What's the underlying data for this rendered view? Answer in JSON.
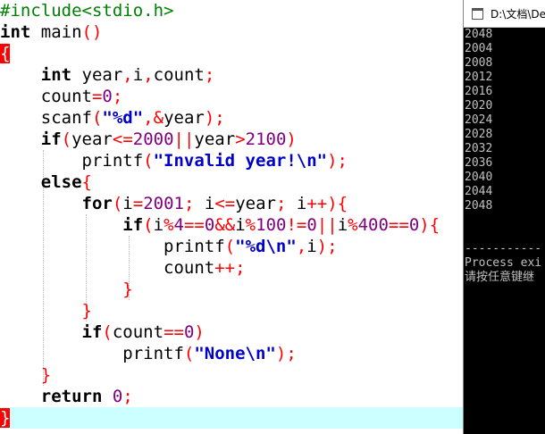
{
  "editor": {
    "lines": [
      {
        "parts": [
          {
            "t": "#include<stdio.h>",
            "c": "pp"
          }
        ]
      },
      {
        "parts": [
          {
            "t": "int",
            "c": "kw"
          },
          {
            "t": " main"
          },
          {
            "t": "()",
            "c": "op"
          }
        ]
      },
      {
        "parts": [
          {
            "t": "{",
            "c": "brace-hl"
          }
        ]
      },
      {
        "parts": [
          {
            "t": "    "
          },
          {
            "t": "int",
            "c": "kw"
          },
          {
            "t": " year"
          },
          {
            "t": ",",
            "c": "op"
          },
          {
            "t": "i"
          },
          {
            "t": ",",
            "c": "op"
          },
          {
            "t": "count"
          },
          {
            "t": ";",
            "c": "op"
          }
        ]
      },
      {
        "parts": [
          {
            "t": "    count"
          },
          {
            "t": "=",
            "c": "op"
          },
          {
            "t": "0",
            "c": "num"
          },
          {
            "t": ";",
            "c": "op"
          }
        ]
      },
      {
        "parts": [
          {
            "t": "    scanf"
          },
          {
            "t": "(",
            "c": "op"
          },
          {
            "t": "\"%d\"",
            "c": "str"
          },
          {
            "t": ",&",
            "c": "op"
          },
          {
            "t": "year"
          },
          {
            "t": ");",
            "c": "op"
          }
        ]
      },
      {
        "parts": [
          {
            "t": "    "
          },
          {
            "t": "if",
            "c": "kw"
          },
          {
            "t": "(",
            "c": "op"
          },
          {
            "t": "year"
          },
          {
            "t": "<=",
            "c": "op"
          },
          {
            "t": "2000",
            "c": "num"
          },
          {
            "t": "||",
            "c": "op"
          },
          {
            "t": "year"
          },
          {
            "t": ">",
            "c": "op"
          },
          {
            "t": "2100",
            "c": "num"
          },
          {
            "t": ")",
            "c": "op"
          }
        ]
      },
      {
        "parts": [
          {
            "t": "        printf"
          },
          {
            "t": "(",
            "c": "op"
          },
          {
            "t": "\"Invalid year!\\n\"",
            "c": "str"
          },
          {
            "t": ");",
            "c": "op"
          }
        ]
      },
      {
        "parts": [
          {
            "t": "    "
          },
          {
            "t": "else",
            "c": "kw"
          },
          {
            "t": "{",
            "c": "op"
          }
        ]
      },
      {
        "parts": [
          {
            "t": "        "
          },
          {
            "t": "for",
            "c": "kw"
          },
          {
            "t": "(",
            "c": "op"
          },
          {
            "t": "i"
          },
          {
            "t": "=",
            "c": "op"
          },
          {
            "t": "2001",
            "c": "num"
          },
          {
            "t": ";",
            "c": "op"
          },
          {
            "t": " i"
          },
          {
            "t": "<=",
            "c": "op"
          },
          {
            "t": "year"
          },
          {
            "t": ";",
            "c": "op"
          },
          {
            "t": " i"
          },
          {
            "t": "++){",
            "c": "op"
          }
        ]
      },
      {
        "parts": [
          {
            "t": "            "
          },
          {
            "t": "if",
            "c": "kw"
          },
          {
            "t": "(",
            "c": "op"
          },
          {
            "t": "i"
          },
          {
            "t": "%",
            "c": "op"
          },
          {
            "t": "4",
            "c": "num"
          },
          {
            "t": "==",
            "c": "op"
          },
          {
            "t": "0",
            "c": "num"
          },
          {
            "t": "&&",
            "c": "op"
          },
          {
            "t": "i"
          },
          {
            "t": "%",
            "c": "op"
          },
          {
            "t": "100",
            "c": "num"
          },
          {
            "t": "!=",
            "c": "op"
          },
          {
            "t": "0",
            "c": "num"
          },
          {
            "t": "||",
            "c": "op"
          },
          {
            "t": "i"
          },
          {
            "t": "%",
            "c": "op"
          },
          {
            "t": "400",
            "c": "num"
          },
          {
            "t": "==",
            "c": "op"
          },
          {
            "t": "0",
            "c": "num"
          },
          {
            "t": "){",
            "c": "op"
          }
        ]
      },
      {
        "parts": [
          {
            "t": "                printf"
          },
          {
            "t": "(",
            "c": "op"
          },
          {
            "t": "\"%d\\n\"",
            "c": "str"
          },
          {
            "t": ",",
            "c": "op"
          },
          {
            "t": "i"
          },
          {
            "t": ");",
            "c": "op"
          }
        ]
      },
      {
        "parts": [
          {
            "t": "                count"
          },
          {
            "t": "++;",
            "c": "op"
          }
        ]
      },
      {
        "parts": [
          {
            "t": "            "
          },
          {
            "t": "}",
            "c": "op"
          }
        ]
      },
      {
        "parts": [
          {
            "t": "        "
          },
          {
            "t": "}",
            "c": "op"
          }
        ]
      },
      {
        "parts": [
          {
            "t": "        "
          },
          {
            "t": "if",
            "c": "kw"
          },
          {
            "t": "(",
            "c": "op"
          },
          {
            "t": "count"
          },
          {
            "t": "==",
            "c": "op"
          },
          {
            "t": "0",
            "c": "num"
          },
          {
            "t": ")",
            "c": "op"
          }
        ]
      },
      {
        "parts": [
          {
            "t": "            printf"
          },
          {
            "t": "(",
            "c": "op"
          },
          {
            "t": "\"None\\n\"",
            "c": "str"
          },
          {
            "t": ");",
            "c": "op"
          }
        ]
      },
      {
        "parts": [
          {
            "t": "    "
          },
          {
            "t": "}",
            "c": "op"
          }
        ]
      },
      {
        "parts": [
          {
            "t": "    "
          },
          {
            "t": "return",
            "c": "kw"
          },
          {
            "t": " "
          },
          {
            "t": "0",
            "c": "num"
          },
          {
            "t": ";",
            "c": "op"
          }
        ]
      },
      {
        "parts": [
          {
            "t": "}",
            "c": "brace-hl"
          }
        ],
        "current": true
      }
    ]
  },
  "console": {
    "title": "D:\\文档\\De",
    "output": [
      "2048",
      "2004",
      "2008",
      "2012",
      "2016",
      "2020",
      "2024",
      "2028",
      "2032",
      "2036",
      "2040",
      "2044",
      "2048",
      "",
      "",
      "-----------",
      "Process exi",
      "请按任意键继"
    ]
  }
}
